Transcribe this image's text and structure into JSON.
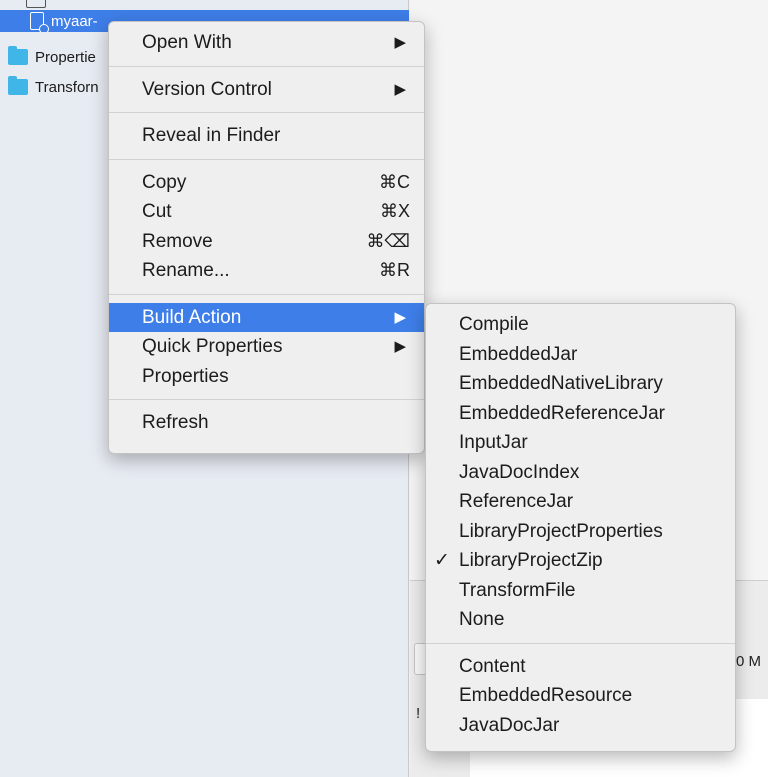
{
  "sidebar": {
    "items": [
      {
        "label": "myaar-",
        "selected": true,
        "icon": "file-icon"
      },
      {
        "label": "Propertie",
        "icon": "folder-icon"
      },
      {
        "label": "Transforn",
        "icon": "folder-icon"
      }
    ]
  },
  "bottom_panel": {
    "frag1": "0 M",
    "frag2": "!"
  },
  "context_menu": {
    "open_with": "Open With",
    "version_control": "Version Control",
    "reveal_in_finder": "Reveal in Finder",
    "copy": "Copy",
    "copy_shortcut": "⌘C",
    "cut": "Cut",
    "cut_shortcut": "⌘X",
    "remove": "Remove",
    "remove_shortcut": "⌘⌫",
    "rename": "Rename...",
    "rename_shortcut": "⌘R",
    "build_action": "Build Action",
    "quick_properties": "Quick Properties",
    "properties": "Properties",
    "refresh": "Refresh",
    "submenu_arrow": "▶"
  },
  "build_action_submenu": {
    "items": [
      "Compile",
      "EmbeddedJar",
      "EmbeddedNativeLibrary",
      "EmbeddedReferenceJar",
      "InputJar",
      "JavaDocIndex",
      "ReferenceJar",
      "LibraryProjectProperties",
      "LibraryProjectZip",
      "TransformFile",
      "None"
    ],
    "extra_items": [
      "Content",
      "EmbeddedResource",
      "JavaDocJar"
    ],
    "checked_item": "LibraryProjectZip",
    "check_glyph": "✓"
  },
  "colors": {
    "selection": "#3e7ee8",
    "folder": "#3fb5e8",
    "menu_bg": "#efefef"
  }
}
